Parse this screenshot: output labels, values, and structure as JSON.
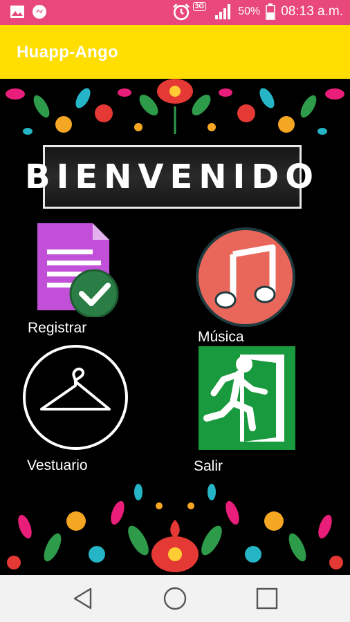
{
  "status_bar": {
    "icons": [
      "image-icon",
      "messenger-icon",
      "alarm-icon",
      "signal-icon",
      "battery-icon"
    ],
    "network": "3G",
    "battery": "50%",
    "time": "08:13 a.m.",
    "color": "#e8487a"
  },
  "app_bar": {
    "title": "Huapp-Ango",
    "color": "#ffde00"
  },
  "banner": {
    "text": "BIENVENIDO"
  },
  "menu": {
    "registrar": {
      "label": "Registrar",
      "icon": "document-check-icon"
    },
    "musica": {
      "label": "Música",
      "icon": "music-note-icon"
    },
    "vestuario": {
      "label": "Vestuario",
      "icon": "hanger-icon"
    },
    "salir": {
      "label": "Salir",
      "icon": "exit-door-icon"
    }
  },
  "nav_bar": {
    "icons": [
      "back-icon",
      "home-icon",
      "recents-icon"
    ]
  }
}
